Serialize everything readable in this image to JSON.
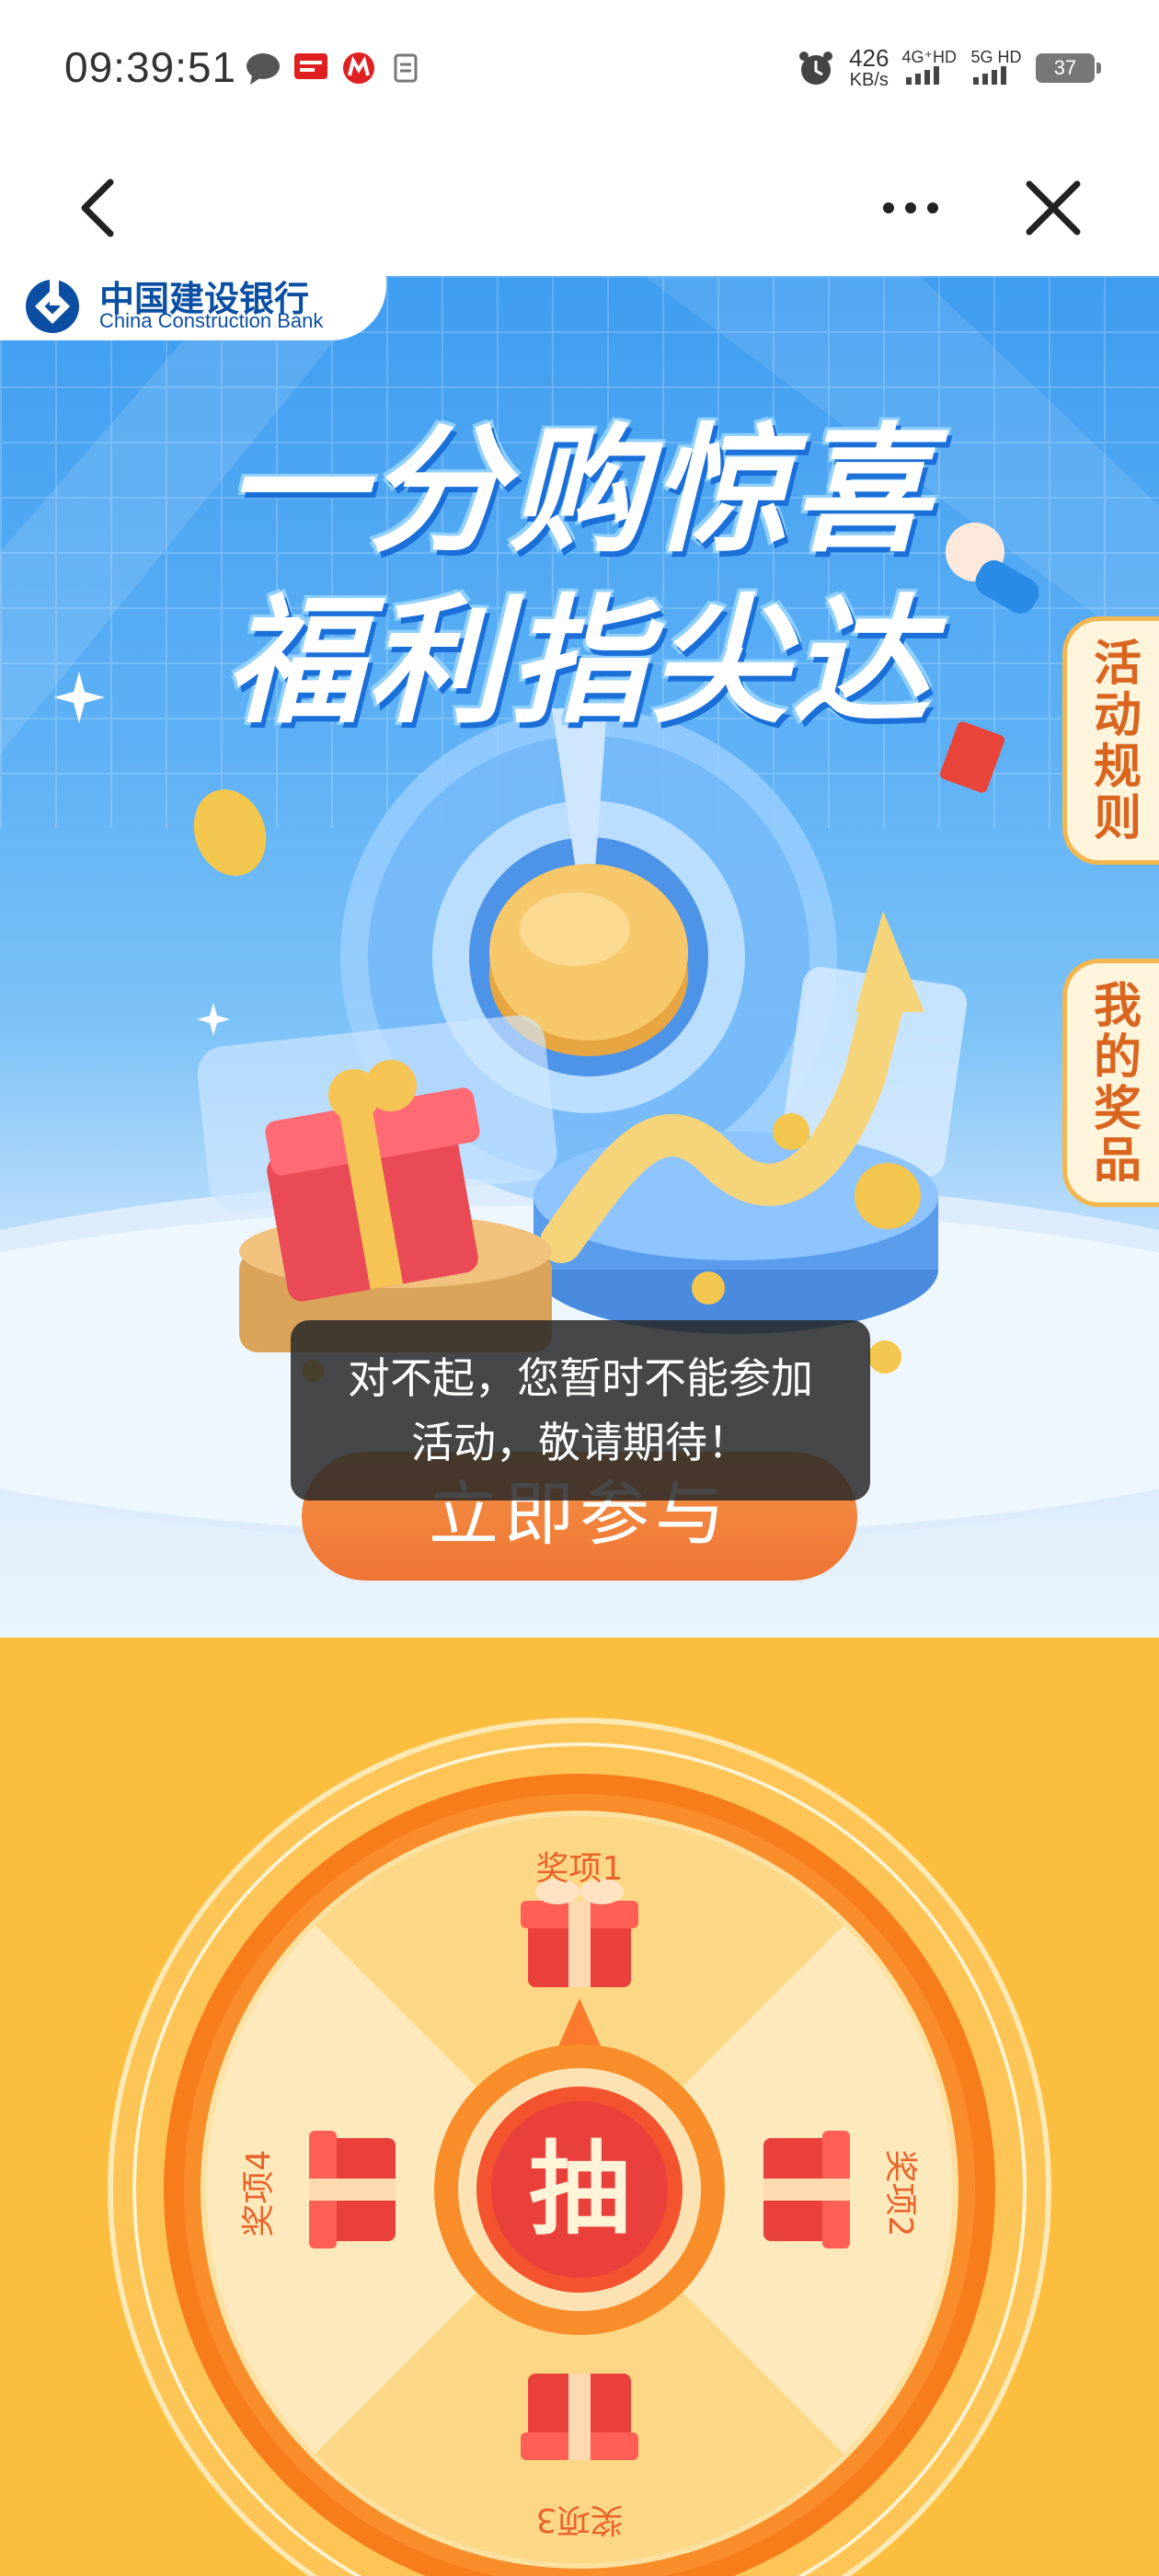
{
  "status_bar": {
    "time": "09:39:51",
    "speed_value": "426",
    "speed_unit": "KB/s",
    "net1": "4G⁺HD",
    "net2": "5G HD",
    "battery": "37"
  },
  "nav": {
    "back_icon": "chevron-left-icon",
    "more_icon": "more-dots-icon",
    "close_icon": "close-icon"
  },
  "hero": {
    "bank_name_cn": "中国建设银行",
    "bank_name_en": "China Construction Bank",
    "headline_line1": "一分购惊喜",
    "headline_line2": "福利指尖达",
    "tab_rules": "活动规则",
    "tab_prizes": "我的奖品",
    "join_button": "立即参与"
  },
  "toast": {
    "line1": "对不起，您暂时不能参加",
    "line2": "活动，敬请期待！"
  },
  "lottery": {
    "center_button": "抽",
    "prize1": "奖项1",
    "prize2": "奖项2",
    "prize3": "奖项3",
    "prize4": "奖项4"
  },
  "colors": {
    "hero_blue": "#3f9df0",
    "button_orange": "#ef7434",
    "lottery_yellow": "#fcbe3e",
    "wheel_orange": "#f77c1a",
    "ccb_blue": "#0b4fa3"
  }
}
